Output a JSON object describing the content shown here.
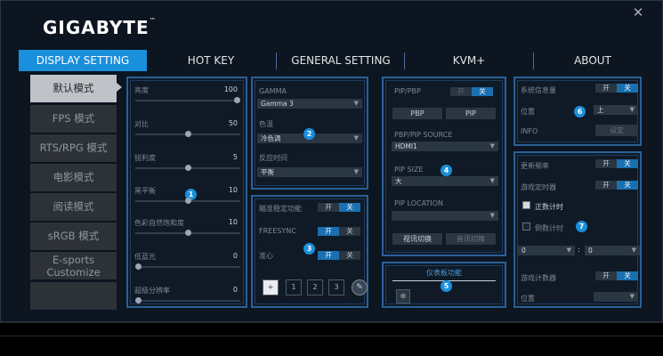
{
  "app": {
    "logo": "GIGABYTE",
    "logo_tm": "™",
    "close_icon": "✕"
  },
  "tabs": [
    {
      "label": "DISPLAY SETTING",
      "active": true
    },
    {
      "label": "HOT KEY",
      "active": false
    },
    {
      "label": "GENERAL SETTING",
      "active": false
    },
    {
      "label": "KVM+",
      "active": false
    },
    {
      "label": "ABOUT",
      "active": false
    }
  ],
  "sidebar": [
    {
      "label": "默认模式",
      "active": true
    },
    {
      "label": "FPS 模式"
    },
    {
      "label": "RTS/RPG 模式"
    },
    {
      "label": "电影模式"
    },
    {
      "label": "阅读模式"
    },
    {
      "label": "sRGB 模式"
    },
    {
      "label": "E-sports",
      "label2": "Customize"
    },
    {
      "label": ""
    }
  ],
  "picture": {
    "badge": "1",
    "sliders": [
      {
        "label": "亮度",
        "value": "100",
        "level": 1.0
      },
      {
        "label": "对比",
        "value": "50",
        "level": 0.5
      },
      {
        "label": "锐利度",
        "value": "5",
        "level": 0.5
      },
      {
        "label": "黑平衡",
        "value": "10",
        "level": 0.5
      },
      {
        "label": "色彩自然饱和度",
        "value": "10",
        "level": 0.5
      },
      {
        "label": "低蓝光",
        "value": "0",
        "level": 0.0
      },
      {
        "label": "超级分辨率",
        "value": "0",
        "level": 0.0
      }
    ]
  },
  "color": {
    "badge": "2",
    "gamma_label": "GAMMA",
    "gamma_value": "Gamma 3",
    "temp_label": "色温",
    "temp_value": "冷色调",
    "response_label": "反应时间",
    "response_value": "平衡"
  },
  "gaming": {
    "badge": "3",
    "aim_label": "瞄准稳定功能",
    "aim_on": "开",
    "aim_off": "关",
    "freesync_label": "FREESYNC",
    "freesync_on": "开",
    "freesync_off": "关",
    "crosshair_label": "准心",
    "crosshair_on": "开",
    "crosshair_off": "关",
    "crosshair_options": [
      "1",
      "2",
      "3"
    ]
  },
  "pip": {
    "badge": "4",
    "pipbbp_label": "PIP/PBP",
    "pipbbp_on": "开",
    "pipbbp_off": "关",
    "pbp_button": "PBP",
    "pip_button": "PIP",
    "source_label": "PBP/PIP SOURCE",
    "source_value": "HDMI1",
    "size_label": "PIP SIZE",
    "size_value": "大",
    "location_label": "PIP LOCATION",
    "location_value": "",
    "swap_button": "视讯切换",
    "audio_button": "音讯切换"
  },
  "dashboard": {
    "badge": "5",
    "title": "仪表板功能"
  },
  "info": {
    "badge": "6",
    "info_label": "系统信息量",
    "info_on": "开",
    "info_off": "关",
    "pos_label": "位置",
    "pos_value": "上",
    "info2_label": "INFO",
    "info2_button": "设定"
  },
  "timer": {
    "badge": "7",
    "refresh_label": "更新频率",
    "refresh_on": "开",
    "refresh_off": "关",
    "gametimer_label": "游戏定时器",
    "gametimer_on": "开",
    "gametimer_off": "关",
    "countup_label": "正数计时",
    "countdown_label": "倒数计时",
    "min_value": "0",
    "sep": ":",
    "sec_value": "0",
    "counter_label": "游戏计数器",
    "counter_on": "开",
    "counter_off": "关",
    "pos_label": "位置",
    "pos_value": ""
  }
}
